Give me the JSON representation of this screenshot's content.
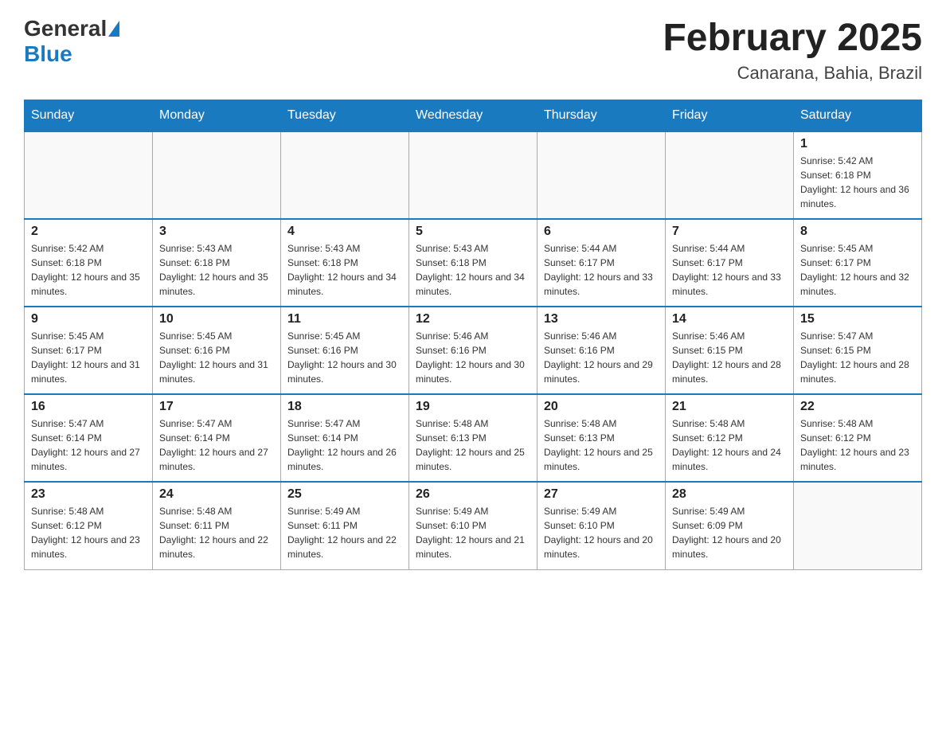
{
  "header": {
    "logo": {
      "general": "General",
      "blue": "Blue"
    },
    "title": "February 2025",
    "location": "Canarana, Bahia, Brazil"
  },
  "weekdays": [
    "Sunday",
    "Monday",
    "Tuesday",
    "Wednesday",
    "Thursday",
    "Friday",
    "Saturday"
  ],
  "weeks": [
    [
      {
        "day": "",
        "info": ""
      },
      {
        "day": "",
        "info": ""
      },
      {
        "day": "",
        "info": ""
      },
      {
        "day": "",
        "info": ""
      },
      {
        "day": "",
        "info": ""
      },
      {
        "day": "",
        "info": ""
      },
      {
        "day": "1",
        "info": "Sunrise: 5:42 AM\nSunset: 6:18 PM\nDaylight: 12 hours and 36 minutes."
      }
    ],
    [
      {
        "day": "2",
        "info": "Sunrise: 5:42 AM\nSunset: 6:18 PM\nDaylight: 12 hours and 35 minutes."
      },
      {
        "day": "3",
        "info": "Sunrise: 5:43 AM\nSunset: 6:18 PM\nDaylight: 12 hours and 35 minutes."
      },
      {
        "day": "4",
        "info": "Sunrise: 5:43 AM\nSunset: 6:18 PM\nDaylight: 12 hours and 34 minutes."
      },
      {
        "day": "5",
        "info": "Sunrise: 5:43 AM\nSunset: 6:18 PM\nDaylight: 12 hours and 34 minutes."
      },
      {
        "day": "6",
        "info": "Sunrise: 5:44 AM\nSunset: 6:17 PM\nDaylight: 12 hours and 33 minutes."
      },
      {
        "day": "7",
        "info": "Sunrise: 5:44 AM\nSunset: 6:17 PM\nDaylight: 12 hours and 33 minutes."
      },
      {
        "day": "8",
        "info": "Sunrise: 5:45 AM\nSunset: 6:17 PM\nDaylight: 12 hours and 32 minutes."
      }
    ],
    [
      {
        "day": "9",
        "info": "Sunrise: 5:45 AM\nSunset: 6:17 PM\nDaylight: 12 hours and 31 minutes."
      },
      {
        "day": "10",
        "info": "Sunrise: 5:45 AM\nSunset: 6:16 PM\nDaylight: 12 hours and 31 minutes."
      },
      {
        "day": "11",
        "info": "Sunrise: 5:45 AM\nSunset: 6:16 PM\nDaylight: 12 hours and 30 minutes."
      },
      {
        "day": "12",
        "info": "Sunrise: 5:46 AM\nSunset: 6:16 PM\nDaylight: 12 hours and 30 minutes."
      },
      {
        "day": "13",
        "info": "Sunrise: 5:46 AM\nSunset: 6:16 PM\nDaylight: 12 hours and 29 minutes."
      },
      {
        "day": "14",
        "info": "Sunrise: 5:46 AM\nSunset: 6:15 PM\nDaylight: 12 hours and 28 minutes."
      },
      {
        "day": "15",
        "info": "Sunrise: 5:47 AM\nSunset: 6:15 PM\nDaylight: 12 hours and 28 minutes."
      }
    ],
    [
      {
        "day": "16",
        "info": "Sunrise: 5:47 AM\nSunset: 6:14 PM\nDaylight: 12 hours and 27 minutes."
      },
      {
        "day": "17",
        "info": "Sunrise: 5:47 AM\nSunset: 6:14 PM\nDaylight: 12 hours and 27 minutes."
      },
      {
        "day": "18",
        "info": "Sunrise: 5:47 AM\nSunset: 6:14 PM\nDaylight: 12 hours and 26 minutes."
      },
      {
        "day": "19",
        "info": "Sunrise: 5:48 AM\nSunset: 6:13 PM\nDaylight: 12 hours and 25 minutes."
      },
      {
        "day": "20",
        "info": "Sunrise: 5:48 AM\nSunset: 6:13 PM\nDaylight: 12 hours and 25 minutes."
      },
      {
        "day": "21",
        "info": "Sunrise: 5:48 AM\nSunset: 6:12 PM\nDaylight: 12 hours and 24 minutes."
      },
      {
        "day": "22",
        "info": "Sunrise: 5:48 AM\nSunset: 6:12 PM\nDaylight: 12 hours and 23 minutes."
      }
    ],
    [
      {
        "day": "23",
        "info": "Sunrise: 5:48 AM\nSunset: 6:12 PM\nDaylight: 12 hours and 23 minutes."
      },
      {
        "day": "24",
        "info": "Sunrise: 5:48 AM\nSunset: 6:11 PM\nDaylight: 12 hours and 22 minutes."
      },
      {
        "day": "25",
        "info": "Sunrise: 5:49 AM\nSunset: 6:11 PM\nDaylight: 12 hours and 22 minutes."
      },
      {
        "day": "26",
        "info": "Sunrise: 5:49 AM\nSunset: 6:10 PM\nDaylight: 12 hours and 21 minutes."
      },
      {
        "day": "27",
        "info": "Sunrise: 5:49 AM\nSunset: 6:10 PM\nDaylight: 12 hours and 20 minutes."
      },
      {
        "day": "28",
        "info": "Sunrise: 5:49 AM\nSunset: 6:09 PM\nDaylight: 12 hours and 20 minutes."
      },
      {
        "day": "",
        "info": ""
      }
    ]
  ]
}
